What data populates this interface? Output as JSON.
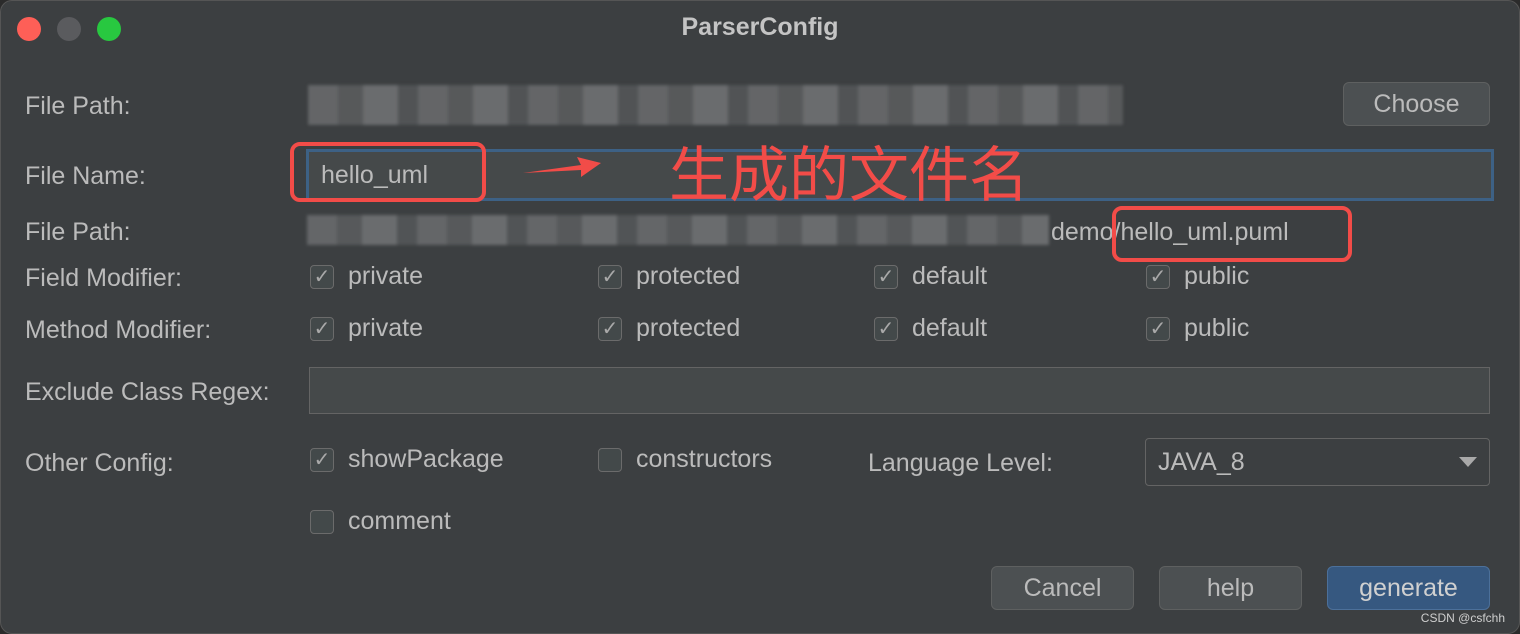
{
  "window": {
    "title": "ParserConfig",
    "controls": [
      "close",
      "minimize",
      "maximize"
    ]
  },
  "form": {
    "file_path_label": "File Path:",
    "choose_button": "Choose",
    "file_name_label": "File Name:",
    "file_name_value": "hello_uml",
    "output_path_label": "File Path:",
    "output_path_visible_suffix_prefix": "demo",
    "output_path_filename": "/hello_uml.puml",
    "field_modifier_label": "Field Modifier:",
    "field_modifiers": [
      {
        "label": "private",
        "checked": true
      },
      {
        "label": "protected",
        "checked": true
      },
      {
        "label": "default",
        "checked": true
      },
      {
        "label": "public",
        "checked": true
      }
    ],
    "method_modifier_label": "Method Modifier:",
    "method_modifiers": [
      {
        "label": "private",
        "checked": true
      },
      {
        "label": "protected",
        "checked": true
      },
      {
        "label": "default",
        "checked": true
      },
      {
        "label": "public",
        "checked": true
      }
    ],
    "exclude_regex_label": "Exclude Class Regex:",
    "exclude_regex_value": "",
    "other_config_label": "Other Config:",
    "other_config": [
      {
        "label": "showPackage",
        "checked": true
      },
      {
        "label": "constructors",
        "checked": false
      },
      {
        "label": "comment",
        "checked": false
      }
    ],
    "language_level_label": "Language Level:",
    "language_level_value": "JAVA_8"
  },
  "buttons": {
    "cancel": "Cancel",
    "help": "help",
    "generate": "generate"
  },
  "annotation": {
    "text": "生成的文件名",
    "color": "#f24c48"
  },
  "colors": {
    "background": "#3c3f41",
    "accent": "#365880",
    "focus_border": "#3d6185"
  },
  "watermark": "CSDN @csfchh",
  "check_glyph": "✓"
}
